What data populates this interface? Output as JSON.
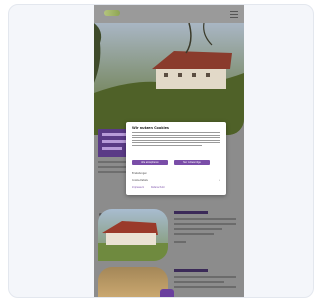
{
  "modal": {
    "title": "Wir nutzen Cookies",
    "accept_label": "Alle akzeptieren",
    "reject_label": "Nur notwendige",
    "settings_row_1": "Einstellungen",
    "settings_row_2": "Cookie-Details",
    "link_1": "Impressum",
    "link_2": "Datenschutz"
  },
  "colors": {
    "accent": "#7a4da8",
    "banner": "#5a3a86"
  }
}
